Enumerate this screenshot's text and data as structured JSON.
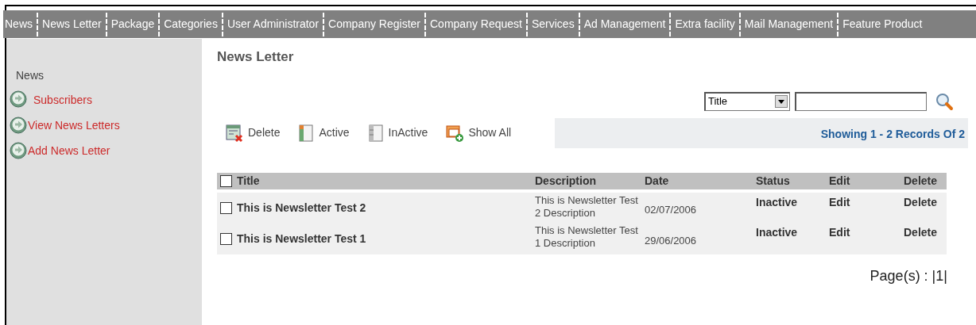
{
  "nav": [
    "News",
    "News Letter",
    "Package",
    "Categories",
    "User Administrator",
    "Company Register",
    "Company Request",
    "Services",
    "Ad Management",
    "Extra facility",
    "Mail Management",
    "Feature Product"
  ],
  "sidebar": {
    "heading": "News",
    "items": [
      "Subscribers",
      "View News Letters",
      "Add News Letter"
    ]
  },
  "page_title": "News Letter",
  "search": {
    "field": "Title"
  },
  "toolbar": [
    {
      "label": "Delete",
      "kind": "delete"
    },
    {
      "label": "Active",
      "kind": "active"
    },
    {
      "label": "InActive",
      "kind": "inactive"
    },
    {
      "label": "Show All",
      "kind": "showall"
    }
  ],
  "records": "Showing 1 - 2 Records Of 2",
  "table": {
    "columns": [
      "Title",
      "Description",
      "Date",
      "Status",
      "Edit",
      "Delete"
    ],
    "all_checked": false,
    "rows": [
      {
        "checked": false,
        "title": "This is Newsletter Test 2",
        "description": "This is Newsletter Test 2 Description",
        "date": "02/07/2006",
        "status": "Inactive",
        "edit": "Edit",
        "delete": "Delete"
      },
      {
        "checked": false,
        "title": "This is Newsletter Test 1",
        "description": "This is Newsletter Test 1 Description",
        "date": "29/06/2006",
        "status": "Inactive",
        "edit": "Edit",
        "delete": "Delete"
      }
    ]
  },
  "pagination": "Page(s) : |1|"
}
